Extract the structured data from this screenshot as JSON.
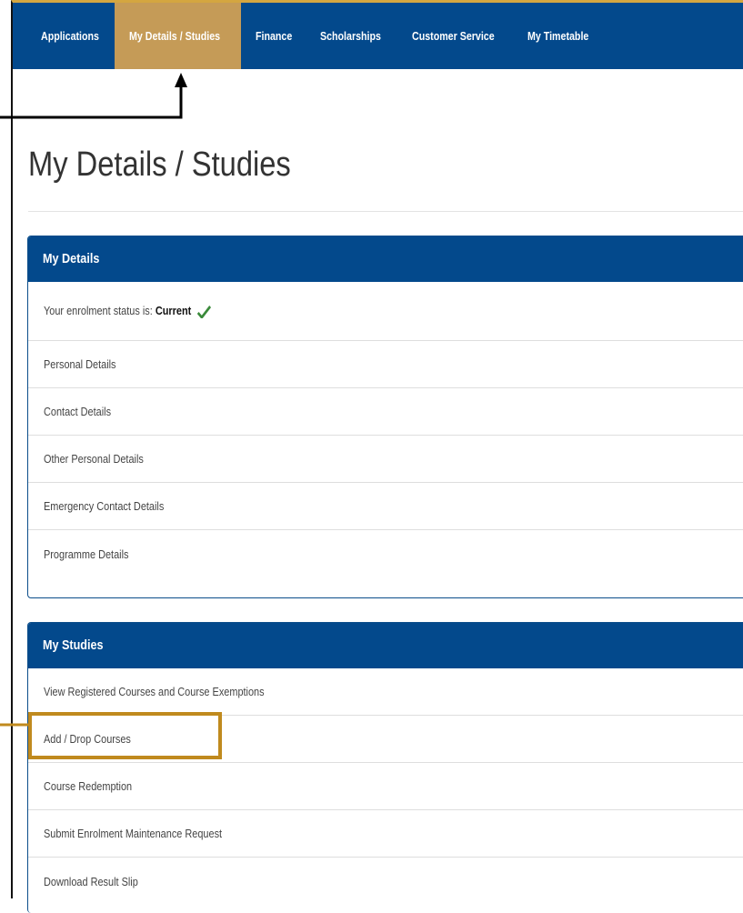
{
  "nav": {
    "items": [
      {
        "label": "Applications",
        "active": false
      },
      {
        "label": "My Details / Studies",
        "active": true
      },
      {
        "label": "Finance",
        "active": false
      },
      {
        "label": "Scholarships",
        "active": false
      },
      {
        "label": "Customer Service",
        "active": false
      },
      {
        "label": "My Timetable",
        "active": false
      }
    ]
  },
  "page": {
    "title": "My Details / Studies"
  },
  "my_details": {
    "heading": "My Details",
    "status_prefix": "Your enrolment status is:",
    "status_value": "Current",
    "items": [
      "Personal Details",
      "Contact Details",
      "Other Personal Details",
      "Emergency Contact Details",
      "Programme Details"
    ]
  },
  "my_studies": {
    "heading": "My Studies",
    "items": [
      "View Registered Courses and Course Exemptions",
      "Add / Drop Courses",
      "Course Redemption",
      "Submit Enrolment Maintenance Request",
      "Download Result Slip"
    ]
  },
  "colors": {
    "nav_bg": "#03498c",
    "nav_active": "#c59b57",
    "highlight": "#c08a1e",
    "check": "#3a8a3a"
  }
}
